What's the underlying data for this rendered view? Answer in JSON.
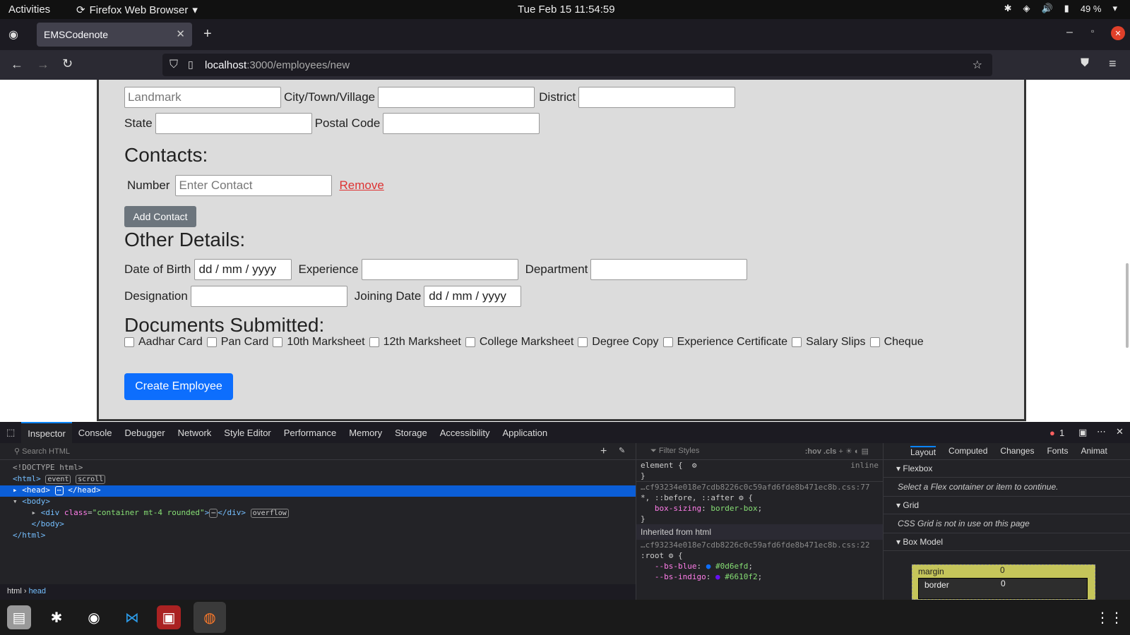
{
  "topbar": {
    "activities": "Activities",
    "app_name": "Firefox Web Browser",
    "clock": "Tue Feb 15  11:54:59",
    "battery": "49 %"
  },
  "browser": {
    "tab_title": "EMSCodenote",
    "url_host": "localhost",
    "url_path": ":3000/employees/new"
  },
  "form": {
    "landmark_placeholder": "Landmark",
    "city_label": "City/Town/Village",
    "district_label": "District",
    "state_label": "State",
    "postal_label": "Postal Code",
    "contacts_heading": "Contacts:",
    "number_label": "Number",
    "contact_placeholder": "Enter Contact",
    "remove_link": "Remove",
    "add_contact": "Add Contact",
    "other_heading": "Other Details:",
    "dob_label": "Date of Birth",
    "date_placeholder": "dd / mm / yyyy",
    "experience_label": "Experience",
    "department_label": "Department",
    "designation_label": "Designation",
    "joining_label": "Joining Date",
    "docs_heading": "Documents Submitted:",
    "documents": [
      "Aadhar Card",
      "Pan Card",
      "10th Marksheet",
      "12th Marksheet",
      "College Marksheet",
      "Degree Copy",
      "Experience Certificate",
      "Salary Slips",
      "Cheque"
    ],
    "create_button": "Create Employee"
  },
  "devtools": {
    "tabs": [
      "Inspector",
      "Console",
      "Debugger",
      "Network",
      "Style Editor",
      "Performance",
      "Memory",
      "Storage",
      "Accessibility",
      "Application"
    ],
    "search_placeholder": "Search HTML",
    "filter_placeholder": "Filter Styles",
    "hov": ":hov",
    "cls": ".cls",
    "error_count": "1",
    "layout_tabs": [
      "Layout",
      "Computed",
      "Changes",
      "Fonts",
      "Animat"
    ],
    "flexbox": "Flexbox",
    "flexbox_msg": "Select a Flex container or item to continue.",
    "grid": "Grid",
    "grid_msg": "CSS Grid is not in use on this page",
    "box_model": "Box Model",
    "margin_label": "margin",
    "border_label": "border",
    "zero": "0",
    "breadcrumb_html": "html",
    "breadcrumb_head": "head",
    "inherited": "Inherited from html",
    "inline": "inline",
    "css_file_1": "…cf93234e018e7cdb8226c0c59afd6fde8b471ec8b.css:77",
    "css_file_2": "…cf93234e018e7cdb8226c0c59afd6fde8b471ec8b.css:22"
  },
  "colors": {
    "accent_blue": "#0d6efd",
    "gray_button": "#6c757d",
    "remove_red": "#dd3333"
  }
}
